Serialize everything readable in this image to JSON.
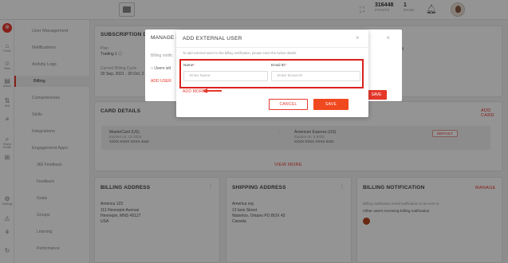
{
  "topbar": {
    "points_value": "316448",
    "points_label": "POINTS",
    "rank_value": "1",
    "rank_label": "RANK"
  },
  "rail": [
    {
      "icon": "⊕",
      "label": ""
    },
    {
      "icon": "⌂",
      "label": "Home"
    },
    {
      "icon": "☺",
      "label": "Team"
    },
    {
      "icon": "▤",
      "label": "Admin"
    },
    {
      "icon": "⇅",
      "label": "Drill"
    },
    {
      "icon": "≡",
      "label": ""
    },
    {
      "icon": "⌕",
      "label": "Teams Profile"
    },
    {
      "icon": "⊞",
      "label": ""
    },
    {
      "icon": "⚙",
      "label": "Settings"
    },
    {
      "icon": "⚠",
      "label": ""
    },
    {
      "icon": "⚘",
      "label": ""
    },
    {
      "icon": "↻",
      "label": ""
    }
  ],
  "menu": [
    "User Management",
    "Notifications",
    "Activity Logs",
    "Billing",
    "Competencies",
    "Skills",
    "Integrations",
    "Engagement Apps",
    "360 Feedback",
    "Feedback",
    "Goals",
    "Groups",
    "Learning",
    "Performance",
    "Recognition Centre"
  ],
  "subscription": {
    "title": "SUBSCRIPTION D",
    "plan_label": "Plan",
    "plan_value": "Trading 1 ⓘ",
    "cycle_label": "Current Billing Cycle",
    "cycle_value": "20 Sep, 2021 - 20 Oct, 2",
    "right_text": "arcel"
  },
  "card_details": {
    "title": "CARD DETAILS",
    "add_card": "ADD CARD",
    "cards": [
      {
        "name": "MasterCard (US)",
        "expires": "Expires on: 12-2024",
        "number": "XXXX XXXX XXXX 4444"
      },
      {
        "name": "American Express (US)",
        "expires": "Expires on: 3-2025",
        "number": "XXXX XXXX XXXX 5431",
        "badge": "DEFAULT"
      }
    ],
    "view_more": "VIEW MORE"
  },
  "billing_address": {
    "title": "BILLING ADDRESS",
    "lines": [
      "America 123",
      "111 Hennepin Avenue",
      "Hennepin, MNS 45127",
      "USA"
    ]
  },
  "shipping_address": {
    "title": "SHIPPING ADDRESS",
    "lines": [
      "America org",
      "13 lane Street",
      "Waterloo, Ontario PO BOX 43",
      "Canada"
    ]
  },
  "billing_notification": {
    "title": "BILLING NOTIFICATION",
    "manage": "MANAGE",
    "line1": "Billing notification email notification to be sent to",
    "line2": "Other users receiving billing notification"
  },
  "bg_modal": {
    "title": "MANAGE E",
    "line1": "Billing notific",
    "radio_label": "Users wit",
    "add_user": "ADD USER",
    "right_text": "a",
    "save": "SAVE"
  },
  "modal": {
    "title": "ADD EXTERNAL USER",
    "description": "To add external users to the billing notification, please enter the below details",
    "name_label": "Name",
    "name_placeholder": "Enter Name",
    "email_label": "Email ID",
    "email_placeholder": "Enter Email ID",
    "add_more": "ADD MORE",
    "cancel": "CANCEL",
    "save": "SAVE"
  }
}
